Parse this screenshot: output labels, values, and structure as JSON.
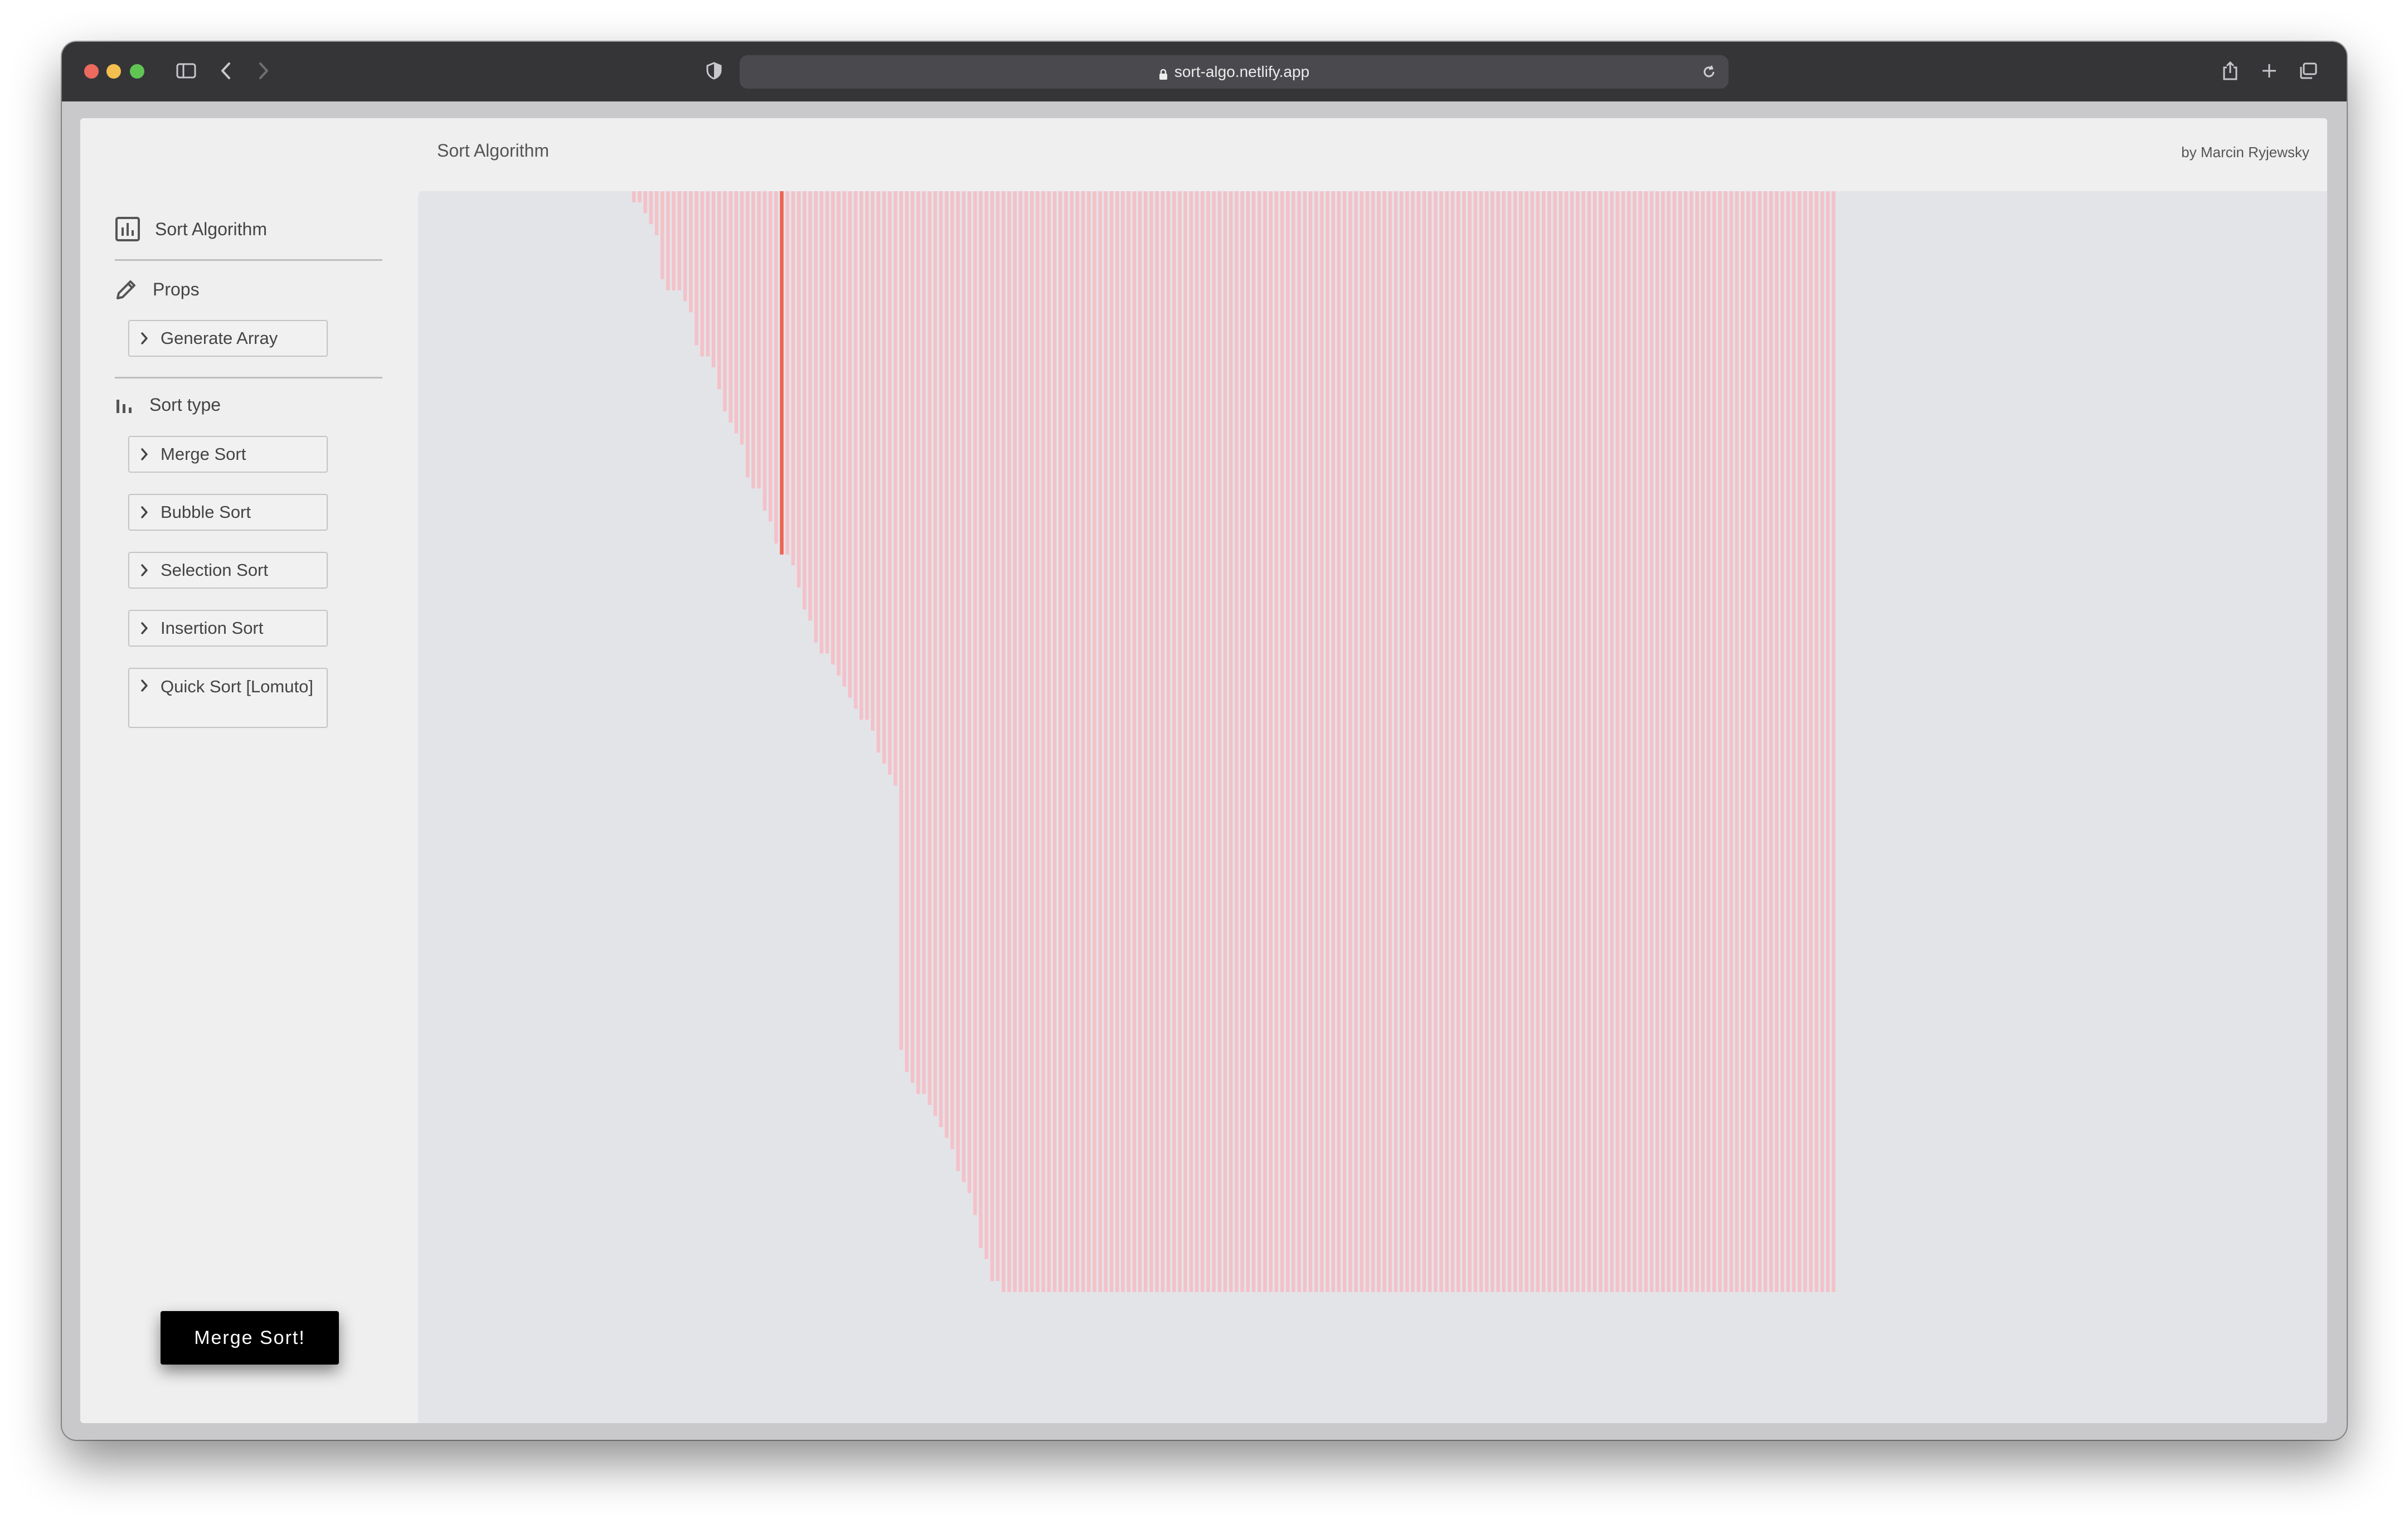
{
  "browser": {
    "url": "sort-algo.netlify.app"
  },
  "header": {
    "title": "Sort Algorithm",
    "author": "by Marcin Ryjewsky"
  },
  "sidebar": {
    "brand": "Sort Algorithm",
    "props_heading": "Props",
    "generate_label": "Generate Array",
    "sort_type_heading": "Sort type",
    "algorithms": [
      "Merge Sort",
      "Bubble Sort",
      "Selection Sort",
      "Insertion Sort"
    ],
    "quick_sort_label": "Quick Sort [Lomuto]"
  },
  "action_button": "Merge Sort!",
  "colors": {
    "bar": "#f4c1c9",
    "highlight": "#ee6352",
    "canvas_bg": "#e3e4e8"
  },
  "chart_data": {
    "type": "bar",
    "orientation": "down",
    "ylim": [
      0,
      100
    ],
    "values": [
      1,
      1,
      2,
      3,
      4,
      8,
      9,
      9,
      9,
      10,
      11,
      14,
      15,
      15,
      16,
      18,
      20,
      21,
      22,
      23,
      26,
      27,
      27,
      29,
      30,
      32,
      33,
      33,
      34,
      36,
      38,
      39,
      41,
      42,
      42,
      43,
      44,
      45,
      46,
      47,
      48,
      48,
      49,
      51,
      52,
      53,
      54,
      78,
      80,
      81,
      82,
      82,
      83,
      84,
      85,
      86,
      87,
      89,
      90,
      91,
      93,
      96,
      97,
      99,
      99,
      100,
      100,
      100,
      100,
      100,
      100,
      100,
      100,
      100,
      100,
      100,
      100,
      100,
      100,
      100,
      100,
      100,
      100,
      100,
      100,
      100,
      100,
      100,
      100,
      100,
      100,
      100,
      100,
      100,
      100,
      100,
      100,
      100,
      100,
      100,
      100,
      100,
      100,
      100,
      100,
      100,
      100,
      100,
      100,
      100,
      100,
      100,
      100,
      100,
      100,
      100,
      100,
      100,
      100,
      100,
      100,
      100,
      100,
      100,
      100,
      100,
      100,
      100,
      100,
      100,
      100,
      100,
      100,
      100,
      100,
      100,
      100,
      100,
      100,
      100,
      100,
      100,
      100,
      100,
      100,
      100,
      100,
      100,
      100,
      100,
      100,
      100,
      100,
      100,
      100,
      100,
      100,
      100,
      100,
      100,
      100,
      100,
      100,
      100,
      100,
      100,
      100,
      100,
      100,
      100,
      100,
      100,
      100,
      100,
      100,
      100,
      100,
      100,
      100,
      100,
      100,
      100,
      100,
      100,
      100,
      100,
      100,
      100,
      100,
      100,
      100,
      100,
      100,
      100,
      100,
      100,
      100,
      100,
      100,
      100,
      100,
      100,
      100,
      100,
      100,
      100,
      100,
      100,
      100,
      100,
      100,
      100
    ],
    "highlight_indices": [
      26
    ]
  }
}
